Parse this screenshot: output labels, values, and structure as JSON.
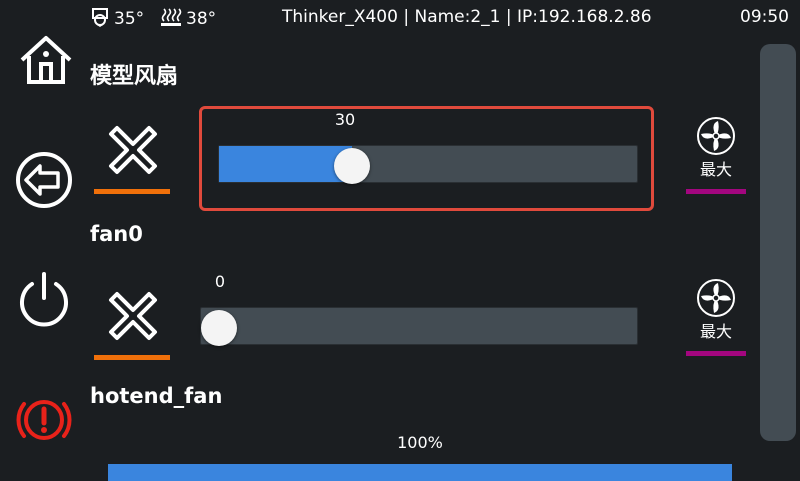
{
  "status_bar": {
    "extruder_temp": "35°",
    "bed_temp": "38°",
    "device_info": "Thinker_X400 | Name:2_1 | IP:192.168.2.86",
    "time": "09:50"
  },
  "nav": {
    "icons": [
      "home-icon",
      "back-icon",
      "power-icon",
      "emergency-stop-icon"
    ]
  },
  "page": {
    "title": "模型风扇"
  },
  "fans": [
    {
      "name": "模型风扇",
      "value_label": "30",
      "value_percent": 30,
      "max_label": "最大"
    },
    {
      "name": "fan0",
      "value_label": "0",
      "value_percent": 0,
      "max_label": "最大"
    },
    {
      "name": "hotend_fan",
      "value_label": "100%",
      "value_percent": 100
    }
  ],
  "colors": {
    "accent_blue": "#3a85de",
    "off_underline": "#f0700a",
    "max_underline": "#a3067f",
    "highlight_border": "#e04a3c",
    "estop_red": "#e8221a"
  }
}
